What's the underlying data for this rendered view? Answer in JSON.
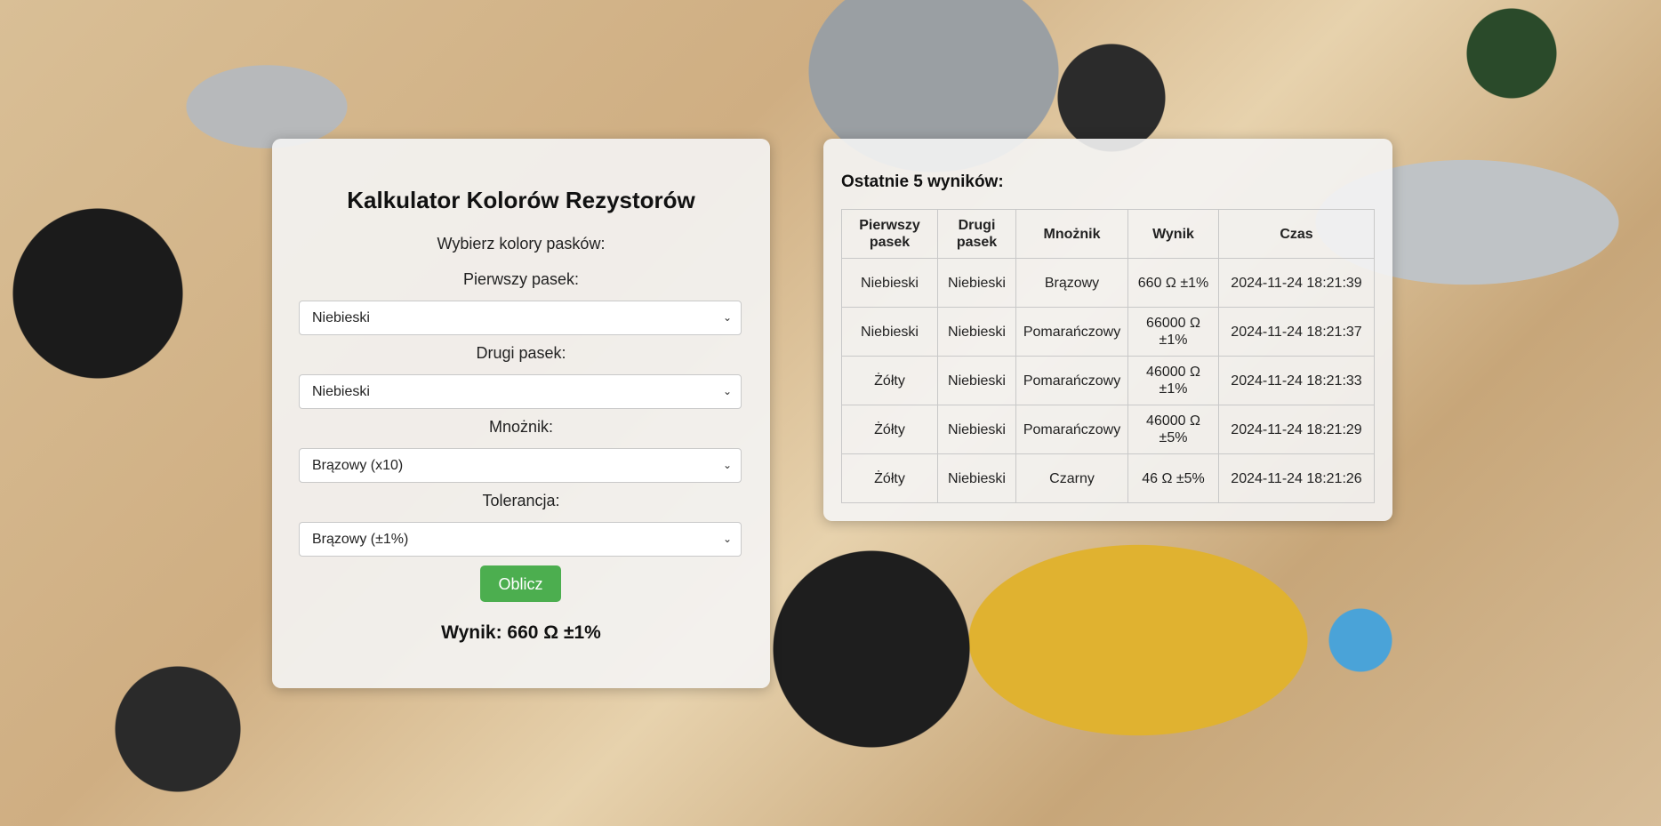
{
  "calculator": {
    "title": "Kalkulator Kolorów Rezystorów",
    "subtitle": "Wybierz kolory pasków:",
    "fields": [
      {
        "label": "Pierwszy pasek:",
        "value": "Niebieski"
      },
      {
        "label": "Drugi pasek:",
        "value": "Niebieski"
      },
      {
        "label": "Mnożnik:",
        "value": "Brązowy (x10)"
      },
      {
        "label": "Tolerancja:",
        "value": "Brązowy (±1%)"
      }
    ],
    "button_label": "Oblicz",
    "result": "Wynik: 660 Ω ±1%",
    "button_color": "#4cae4f"
  },
  "history": {
    "title": "Ostatnie 5 wyników:",
    "columns": [
      "Pierwszy pasek",
      "Drugi pasek",
      "Mnożnik",
      "Wynik",
      "Czas"
    ],
    "rows": [
      {
        "first": "Niebieski",
        "second": "Niebieski",
        "multiplier": "Brązowy",
        "result": "660 Ω ±1%",
        "time": "2024-11-24 18:21:39"
      },
      {
        "first": "Niebieski",
        "second": "Niebieski",
        "multiplier": "Pomarańczowy",
        "result": "66000 Ω ±1%",
        "time": "2024-11-24 18:21:37"
      },
      {
        "first": "Żółty",
        "second": "Niebieski",
        "multiplier": "Pomarańczowy",
        "result": "46000 Ω ±1%",
        "time": "2024-11-24 18:21:33"
      },
      {
        "first": "Żółty",
        "second": "Niebieski",
        "multiplier": "Pomarańczowy",
        "result": "46000 Ω ±5%",
        "time": "2024-11-24 18:21:29"
      },
      {
        "first": "Żółty",
        "second": "Niebieski",
        "multiplier": "Czarny",
        "result": "46 Ω ±5%",
        "time": "2024-11-24 18:21:26"
      }
    ]
  }
}
